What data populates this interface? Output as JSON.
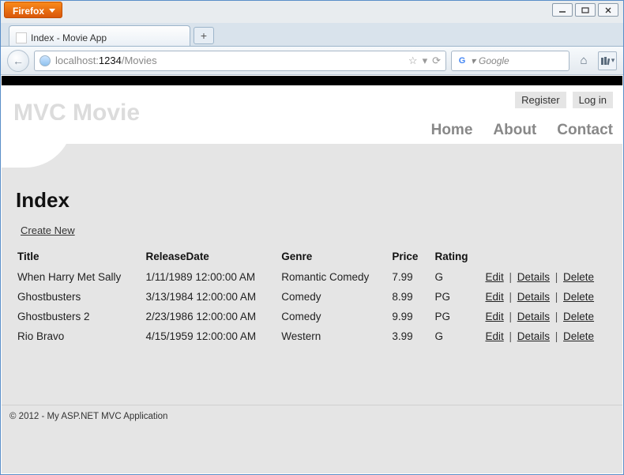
{
  "browser": {
    "name": "Firefox",
    "tab_title": "Index - Movie App",
    "url_host_dim": "localhost:",
    "url_host": "1234",
    "url_path": "/Movies",
    "search_placeholder": "Google",
    "newtab_glyph": "+",
    "back_glyph": "←",
    "star_glyph": "☆",
    "dropdown_glyph": "▾",
    "refresh_glyph": "⟳",
    "home_glyph": "⌂",
    "bookmarks_glyph": "▾"
  },
  "site": {
    "brand": "MVC Movie",
    "register": "Register",
    "login": "Log in",
    "nav": {
      "home": "Home",
      "about": "About",
      "contact": "Contact"
    }
  },
  "page": {
    "heading": "Index",
    "create_label": "Create New",
    "columns": {
      "title": "Title",
      "release": "ReleaseDate",
      "genre": "Genre",
      "price": "Price",
      "rating": "Rating"
    },
    "actions": {
      "edit": "Edit",
      "details": "Details",
      "delete": "Delete"
    }
  },
  "movies": [
    {
      "title": "When Harry Met Sally",
      "release": "1/11/1989 12:00:00 AM",
      "genre": "Romantic Comedy",
      "price": "7.99",
      "rating": "G"
    },
    {
      "title": "Ghostbusters",
      "release": "3/13/1984 12:00:00 AM",
      "genre": "Comedy",
      "price": "8.99",
      "rating": "PG"
    },
    {
      "title": "Ghostbusters 2",
      "release": "2/23/1986 12:00:00 AM",
      "genre": "Comedy",
      "price": "9.99",
      "rating": "PG"
    },
    {
      "title": "Rio Bravo",
      "release": "4/15/1959 12:00:00 AM",
      "genre": "Western",
      "price": "3.99",
      "rating": "G"
    }
  ],
  "footer": "© 2012 - My ASP.NET MVC Application"
}
